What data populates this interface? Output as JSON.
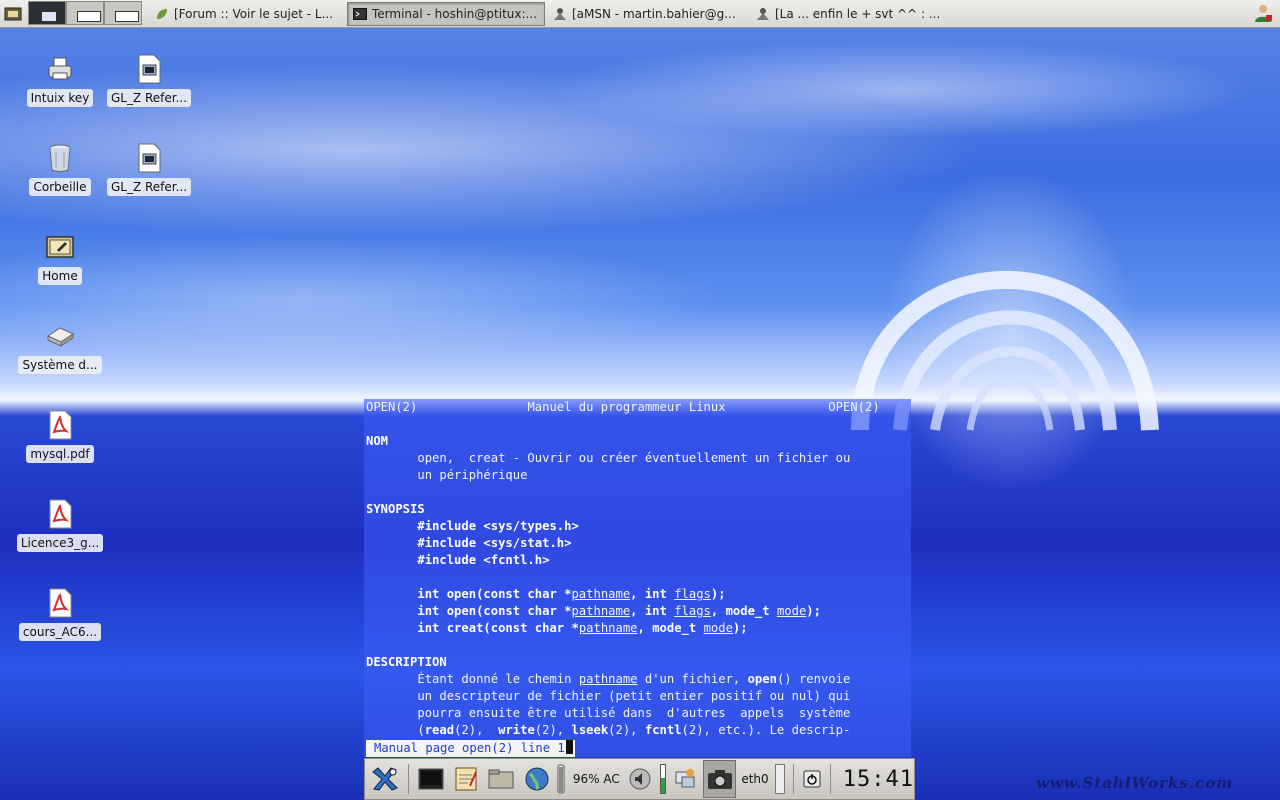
{
  "taskbar": {
    "tasks": [
      {
        "label": "[Forum :: Voir le sujet - L...",
        "icon": "leaf-icon"
      },
      {
        "label": "Terminal - hoshin@ptitux:...",
        "icon": "terminal-icon",
        "active": true
      },
      {
        "label": "[aMSN - martin.bahier@g...",
        "icon": "amsn-icon"
      },
      {
        "label": "[La ... enfin le + svt ^^ : ...",
        "icon": "amsn-icon"
      }
    ]
  },
  "desktop": {
    "icons": [
      {
        "label": "Intuix key",
        "icon": "printer-icon"
      },
      {
        "label": "GL_Z Refer...",
        "icon": "document-icon"
      },
      {
        "label": "Corbeille",
        "icon": "trash-icon"
      },
      {
        "label": "GL_Z Refer...",
        "icon": "document-icon"
      },
      {
        "label": "Home",
        "icon": "home-folder-icon"
      },
      {
        "label": "Système d...",
        "icon": "drive-icon"
      },
      {
        "label": "mysql.pdf",
        "icon": "pdf-icon"
      },
      {
        "label": "Licence3_g...",
        "icon": "pdf-icon"
      },
      {
        "label": "cours_AC6...",
        "icon": "pdf-icon"
      }
    ]
  },
  "terminal": {
    "header_left": "OPEN(2)",
    "header_center": "Manuel du programmeur Linux",
    "header_right": "OPEN(2)",
    "section_nom": "NOM",
    "nom_line1": "open,  creat - Ouvrir ou créer éventuellement un fichier ou",
    "nom_line2": "un périphérique",
    "section_synopsis": "SYNOPSIS",
    "include1": "#include <sys/types.h>",
    "include2": "#include <sys/stat.h>",
    "include3": "#include <fcntl.h>",
    "proto1_a": "int open(const char *",
    "proto1_b": "pathname",
    "proto1_c": ", int ",
    "proto1_d": "flags",
    "proto1_e": ");",
    "proto2_a": "int open(const char *",
    "proto2_b": "pathname",
    "proto2_c": ", int ",
    "proto2_d": "flags",
    "proto2_e": ", mode_t ",
    "proto2_f": "mode",
    "proto2_g": ");",
    "proto3_a": "int creat(const char *",
    "proto3_b": "pathname",
    "proto3_c": ", mode_t ",
    "proto3_d": "mode",
    "proto3_e": ");",
    "section_description": "DESCRIPTION",
    "desc1_a": "Étant donné le chemin ",
    "desc1_b": "pathname",
    "desc1_c": " d'un fichier, ",
    "desc1_d": "open",
    "desc1_e": "() renvoie",
    "desc2": "un descripteur de fichier (petit entier positif ou nul) qui",
    "desc3": "pourra ensuite être utilisé dans  d'autres  appels  système",
    "desc4_a": "(",
    "desc4_b": "read",
    "desc4_c": "(2),  ",
    "desc4_d": "write",
    "desc4_e": "(2), ",
    "desc4_f": "lseek",
    "desc4_g": "(2), ",
    "desc4_h": "fcntl",
    "desc4_i": "(2), etc.). Le descrip-",
    "status": "Manual page open(2) line 1"
  },
  "panel": {
    "battery": "96% AC",
    "network": "eth0",
    "clock": "15:41"
  },
  "wallpaper": {
    "watermark": "www.StahlWorks.com"
  },
  "colors": {
    "terminal_bg": "#3c5af5",
    "status_text": "#2340c8",
    "panel_bg": "#d7d5d0"
  }
}
